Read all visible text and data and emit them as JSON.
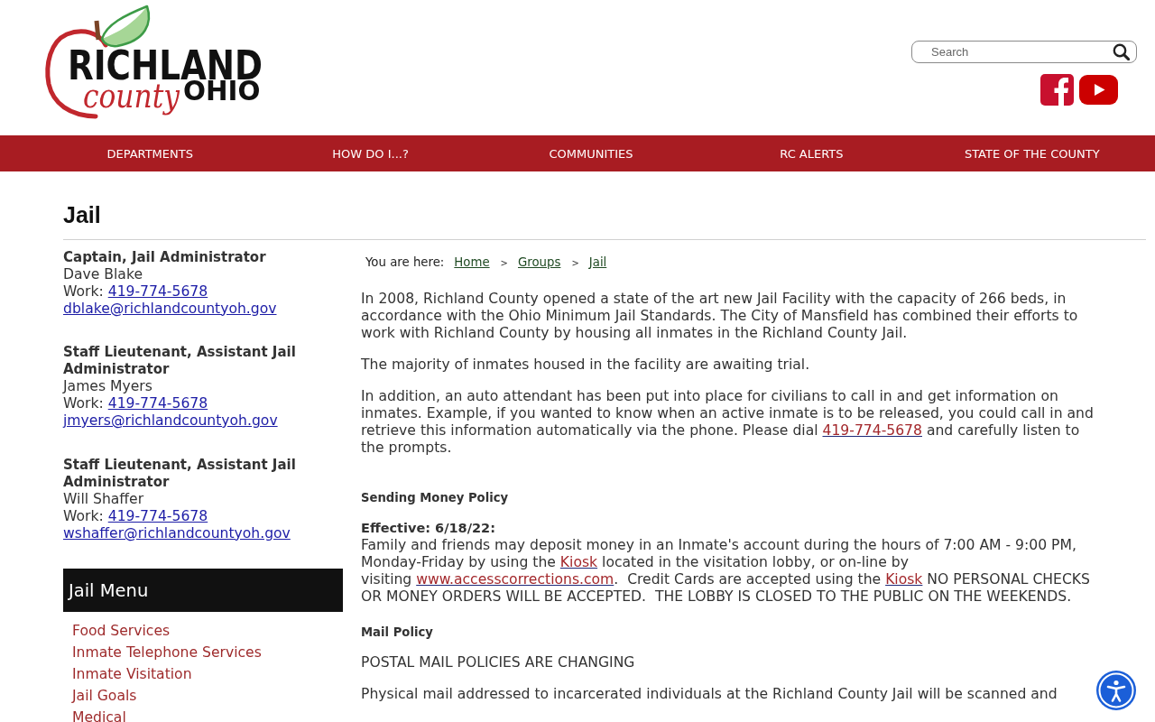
{
  "header": {
    "logo": {
      "line_1": "RICHLAND",
      "script": "county",
      "line_2": "OHIO"
    },
    "search": {
      "placeholder": "Search"
    }
  },
  "nav": {
    "items": [
      "DEPARTMENTS",
      "HOW DO I...?",
      "COMMUNITIES",
      "RC ALERTS",
      "STATE OF THE COUNTY"
    ]
  },
  "page_title": "Jail",
  "contacts": [
    {
      "title": "Captain, Jail Administrator",
      "name": "Dave Blake",
      "phone_label": "Work:",
      "phone": "419-774-5678",
      "email": "dblake@richlandcountyoh.gov"
    },
    {
      "title": "Staff Lieutenant, Assistant Jail Administrator",
      "name": "James Myers",
      "phone_label": "Work:",
      "phone": "419-774-5678",
      "email": "jmyers@richlandcountyoh.gov"
    },
    {
      "title": "Staff Lieutenant, Assistant Jail Administrator",
      "name": "Will Shaffer",
      "phone_label": "Work:",
      "phone": "419-774-5678",
      "email": "wshaffer@richlandcountyoh.gov"
    }
  ],
  "jail_menu": {
    "title": "Jail Menu",
    "items": [
      "Food Services",
      "Inmate Telephone Services",
      "Inmate Visitation",
      "Jail Goals",
      "Medical"
    ]
  },
  "breadcrumb": {
    "label": "You are here:",
    "items": [
      {
        "kind": "link",
        "text": "Home"
      },
      {
        "kind": "separator",
        "text": ">"
      },
      {
        "kind": "link",
        "text": "Groups"
      },
      {
        "kind": "separator",
        "text": ">"
      },
      {
        "kind": "link",
        "text": "Jail"
      }
    ]
  },
  "content": [
    {
      "kind": "paragraph",
      "parts": [
        {
          "kind": "text",
          "text": "In 2008, Richland County opened a state of the art new Jail Facility with the capacity of 266 beds, in accordance with the Ohio Minimum Jail Standards. The City of Mansfield has combined their efforts to work with Richland County by housing all inmates in the Richland County Jail."
        }
      ]
    },
    {
      "kind": "paragraph",
      "parts": [
        {
          "kind": "text",
          "text": "The majority of inmates housed in the facility are awaiting trial."
        }
      ]
    },
    {
      "kind": "paragraph",
      "parts": [
        {
          "kind": "text",
          "text": "In addition, an auto attendant has been put into place for civilians to call in and get information on inmates. Example, if you wanted to know when an active inmate is to be released, you could call in and retrieve this information automatically via the phone. Please dial "
        },
        {
          "kind": "link",
          "text": "419-774-5678"
        },
        {
          "kind": "text",
          "text": " and carefully listen to the prompts."
        }
      ]
    },
    {
      "kind": "heading",
      "text": "Sending Money Policy"
    },
    {
      "kind": "subheading",
      "text": "Effective: 6/18/22:"
    },
    {
      "kind": "paragraph",
      "parts": [
        {
          "kind": "text",
          "text": "Family and friends may deposit money in an Inmate's account during the hours of 7:00 AM - 9:00 PM, Monday-Friday by using the "
        },
        {
          "kind": "link",
          "text": "Kiosk"
        },
        {
          "kind": "text",
          "text": " located in the visitation lobby, or on-line by visiting "
        },
        {
          "kind": "link",
          "text": "www.accesscorrections.com"
        },
        {
          "kind": "text",
          "text": ".  Credit Cards are accepted using the "
        },
        {
          "kind": "link",
          "text": "Kiosk"
        },
        {
          "kind": "text",
          "text": " NO PERSONAL CHECKS OR MONEY ORDERS WILL BE ACCEPTED.  THE LOBBY IS CLOSED TO THE PUBLIC ON THE WEEKENDS."
        }
      ]
    },
    {
      "kind": "heading",
      "text": "Mail Policy"
    },
    {
      "kind": "paragraph",
      "parts": [
        {
          "kind": "text",
          "text": "POSTAL MAIL POLICIES ARE CHANGING"
        }
      ]
    },
    {
      "kind": "paragraph",
      "parts": [
        {
          "kind": "text",
          "text": "Physical mail addressed to incarcerated individuals at the Richland County Jail will be scanned and"
        }
      ]
    }
  ]
}
